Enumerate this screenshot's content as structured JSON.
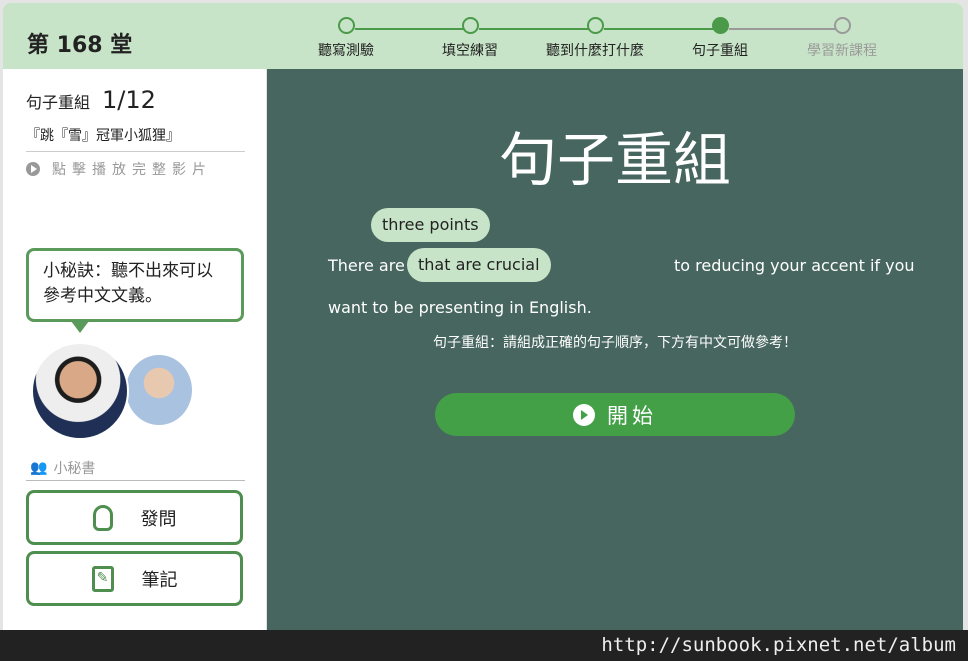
{
  "header": {
    "lesson": "第 168 堂",
    "steps": [
      {
        "label": "聽寫測驗",
        "state": "done"
      },
      {
        "label": "填空練習",
        "state": "done"
      },
      {
        "label": "聽到什麼打什麼",
        "state": "done"
      },
      {
        "label": "句子重組",
        "state": "current"
      },
      {
        "label": "學習新課程",
        "state": "todo"
      }
    ]
  },
  "sidebar": {
    "section": "句子重組",
    "progress": "1/12",
    "title": "『跳『雪』冠軍小狐狸』",
    "play_full": "點擊播放完整影片",
    "tip": "小秘訣：聽不出來可以參考中文文義。",
    "assistant": "小秘書",
    "ask": "發問",
    "notes": "筆記"
  },
  "main": {
    "title": "句子重組",
    "chips": [
      "three points",
      "that are crucial"
    ],
    "text_before": "There are",
    "text_after": "to reducing your accent if you",
    "text_line2": "want to be presenting in English.",
    "instruction": "句子重組：請組成正確的句子順序，下方有中文可做參考！",
    "start": "開始"
  },
  "footer": {
    "url": "http://sunbook.pixnet.net/album"
  },
  "colors": {
    "header": "#c8e4c8",
    "accent": "#4a9a4a",
    "main_bg": "#476660",
    "start_button": "#43a047"
  }
}
